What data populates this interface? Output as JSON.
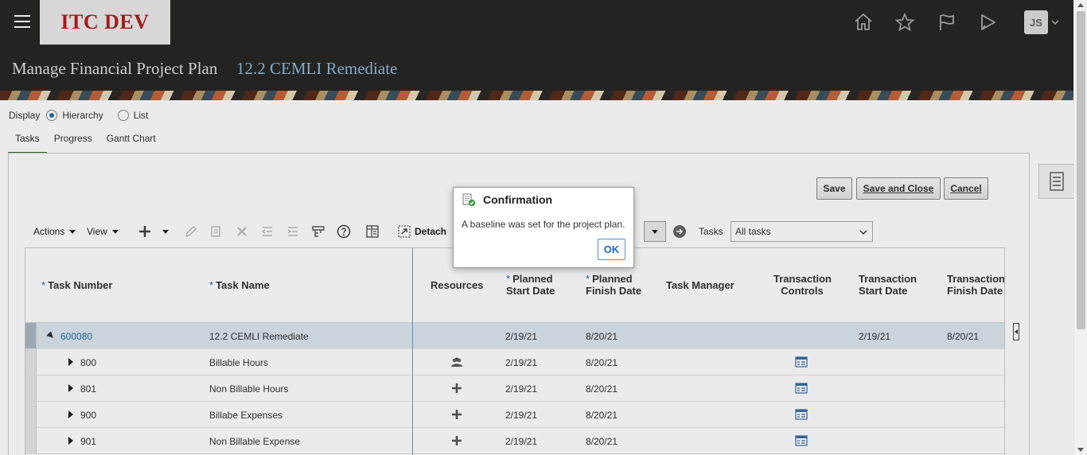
{
  "header": {
    "logo_text": "ITC DEV",
    "user_initials": "JS"
  },
  "title": {
    "main": "Manage Financial Project Plan",
    "project": "12.2 CEMLI Remediate"
  },
  "display": {
    "label": "Display",
    "options": [
      "Hierarchy",
      "List"
    ],
    "selected": "Hierarchy"
  },
  "tabs": [
    "Tasks",
    "Progress",
    "Gantt Chart"
  ],
  "buttons": {
    "save": "Save",
    "save_close": "Save and Close",
    "cancel": "Cancel"
  },
  "toolbar": {
    "actions": "Actions",
    "view": "View",
    "detach": "Detach",
    "tasks_label": "Tasks",
    "tasks_filter": "All tasks"
  },
  "table": {
    "columns": {
      "task_number": "Task Number",
      "task_name": "Task Name",
      "resources": "Resources",
      "planned_start_1": "Planned",
      "planned_start_2": "Start Date",
      "planned_finish_1": "Planned",
      "planned_finish_2": "Finish Date",
      "task_manager": "Task Manager",
      "tc_1": "Transaction",
      "tc_2": "Controls",
      "ts_1": "Transaction",
      "ts_2": "Start Date",
      "tf_1": "Transaction",
      "tf_2": "Finish Date"
    },
    "rows": [
      {
        "number": "600080",
        "name": "12.2 CEMLI Remediate",
        "start": "2/19/21",
        "finish": "8/20/21",
        "tstart": "2/19/21",
        "tfinish": "8/20/21"
      },
      {
        "number": "800",
        "name": "Billable Hours",
        "start": "2/19/21",
        "finish": "8/20/21",
        "tstart": "",
        "tfinish": ""
      },
      {
        "number": "801",
        "name": "Non Billable Hours",
        "start": "2/19/21",
        "finish": "8/20/21",
        "tstart": "",
        "tfinish": ""
      },
      {
        "number": "900",
        "name": "Billabe Expenses",
        "start": "2/19/21",
        "finish": "8/20/21",
        "tstart": "",
        "tfinish": ""
      },
      {
        "number": "901",
        "name": "Non Billable Expense",
        "start": "2/19/21",
        "finish": "8/20/21",
        "tstart": "",
        "tfinish": ""
      }
    ]
  },
  "dialog": {
    "title": "Confirmation",
    "message": "A baseline was set for the project plan.",
    "ok": "OK"
  },
  "colors": {
    "header_bg": "#272624",
    "link": "#2b6cb0",
    "logo_red": "#b71c1c"
  }
}
